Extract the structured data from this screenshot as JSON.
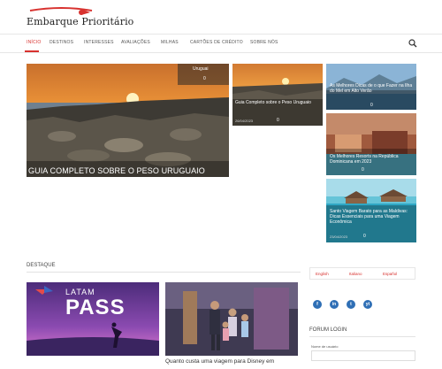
{
  "site": {
    "logo_text": "Embarque Prioritário"
  },
  "nav": {
    "items": [
      "Início",
      "Destinos",
      "Interesses",
      "Avaliações",
      "Milhas",
      "Cartões de Crédito",
      "Sobre nós"
    ]
  },
  "featured": {
    "main": {
      "tag": "Uruguai",
      "comments": "0",
      "title": "GUIA COMPLETO SOBRE O PESO URUGUAIO"
    },
    "side": {
      "title": "Guia Completo sobre o Peso Uruguaio",
      "date": "26/04/2023",
      "comments": "0"
    },
    "right": [
      {
        "title": "As Melhores Dicas de o que Fazer na Ilha do Mel em Alto Verão",
        "comments": "0"
      },
      {
        "title": "Os Melhores Resorts na República Dominicana em 2023",
        "comments": "0"
      },
      {
        "title": "Santo Viagem Barato para as Maldivas: Dicas Essenciais para uma Viagem Econômica",
        "date": "23/04/2023",
        "comments": "0"
      }
    ]
  },
  "destaque": {
    "heading": "Destaque",
    "latam_brand": "LATAM",
    "latam_pass": "PASS",
    "disney_title": "Quanto custa uma viagem para Disney em"
  },
  "sidebar": {
    "languages": [
      "English",
      "Italiano",
      "Español"
    ],
    "social": [
      "f",
      "in",
      "t",
      "yt"
    ],
    "forum_heading": "Forum Login",
    "forum_label": "Nome de usuário"
  },
  "colors": {
    "accent": "#d8322f",
    "social": "#2f6fb5"
  }
}
